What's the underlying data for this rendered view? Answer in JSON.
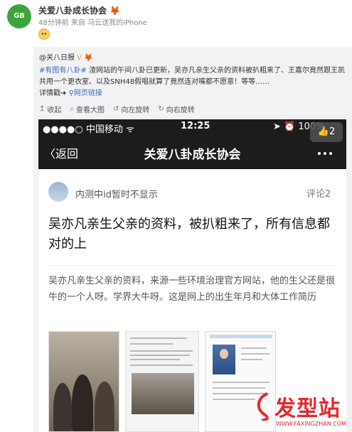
{
  "post": {
    "author": "关爱八卦成长协会",
    "author_badge": "🦊",
    "meta": "48分钟前 来自 马云送我的iPhone",
    "avatar_text": "GB"
  },
  "repost": {
    "author": "@关八日报",
    "author_tags": "V 🦊",
    "topic": "#有图有八卦#",
    "text": " 渣网站的午间八卦已更新，吴亦凡亲生父亲的资料被扒粗来了、王嘉尔竟然跟王凯共用一个更衣室、以及SNH48假唱就算了竟然连对嘴都不愿意！等等……",
    "detail_label": "详情戳➜",
    "link_label": "网页链接",
    "toolbar": [
      {
        "icon": "collapse-icon",
        "glyph": "↥",
        "label": "收起"
      },
      {
        "icon": "magnify-icon",
        "glyph": "⌕",
        "label": "查看大图"
      },
      {
        "icon": "rotate-left-icon",
        "glyph": "↺",
        "label": "向左旋转"
      },
      {
        "icon": "rotate-right-icon",
        "glyph": "↻",
        "label": "向右旋转"
      }
    ]
  },
  "phone": {
    "carrier": "●●●●○ 中国移动 ᯤ",
    "time": "12:25",
    "status_right": "➤ ⏰ 100%",
    "like_badge": "👍2",
    "back_label": "〈返回",
    "title": "关爱八卦成长协会",
    "user_name": "内测中id暂时不显示",
    "comment_count": "评论2",
    "headline": "吴亦凡亲生父亲的资料，被扒粗来了，所有信息都对的上",
    "body": "吴亦凡亲生父亲的资料，来源一些环境治理官方网站，他的生父还是很牛的一个人呀。学界大牛呀。这是网上的出生年月和大体工作简历"
  },
  "watermark": {
    "text": "发型站",
    "url": "WWW.FAXINGZHAN.COM"
  },
  "colors": {
    "accent_link": "#3b6bb3",
    "watermark_red": "#e8262e",
    "phone_bar": "#1c1c1c"
  }
}
